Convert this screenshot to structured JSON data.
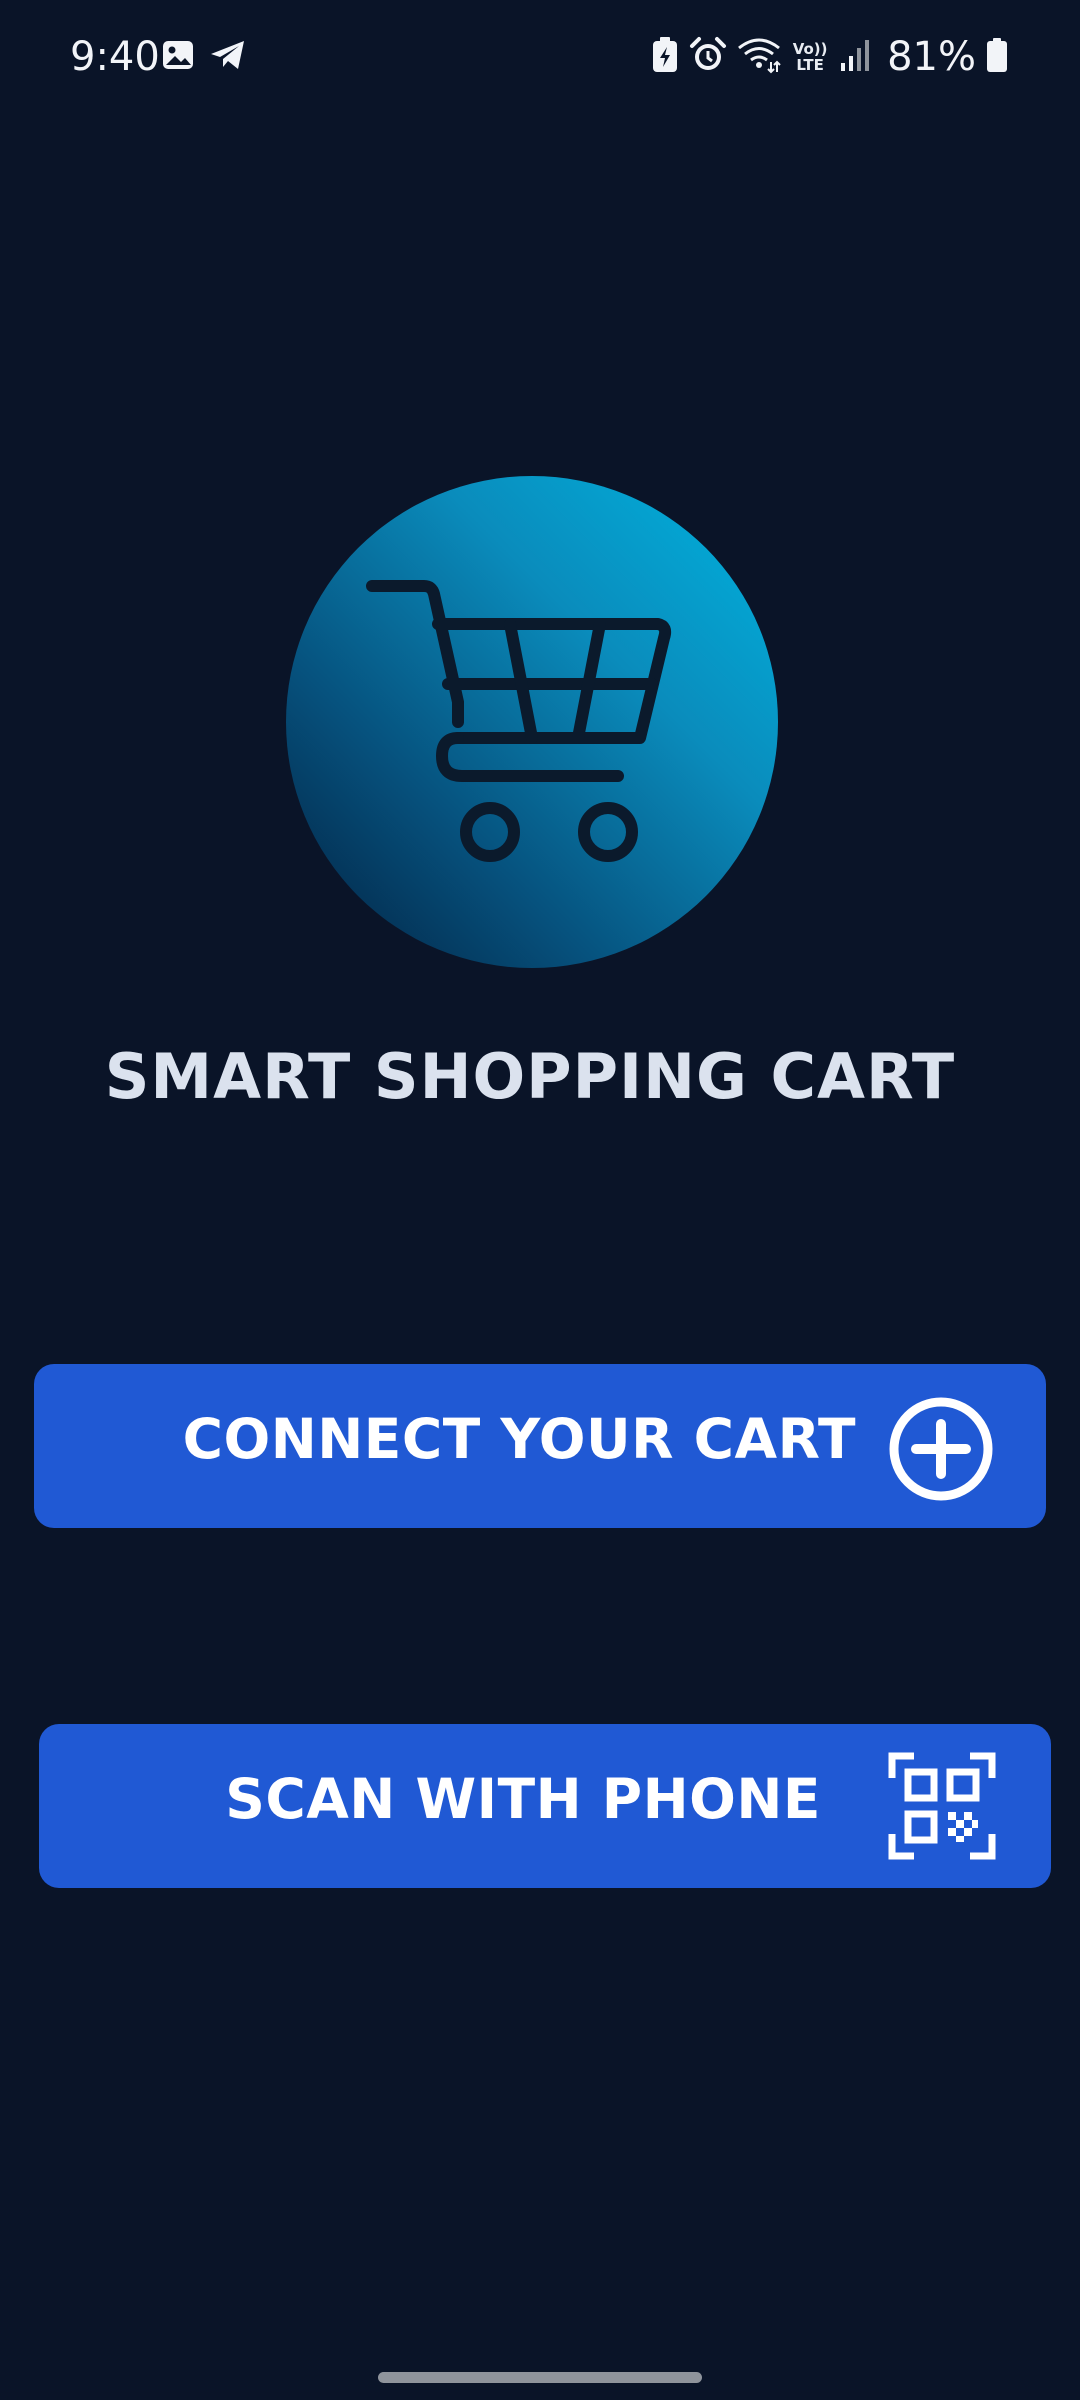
{
  "status_bar": {
    "time": "9:40",
    "network_label": "Vo)) LTE",
    "battery_percent": "81%",
    "left_icons": [
      "image-notification-icon",
      "telegram-icon"
    ],
    "right_icons": [
      "battery-saver-icon",
      "alarm-icon",
      "wifi-icon",
      "volte-icon",
      "cellular-signal-icon",
      "battery-icon"
    ]
  },
  "app": {
    "logo_icon": "shopping-cart-icon",
    "title": "SMART SHOPPING CART"
  },
  "buttons": {
    "connect": {
      "label": "CONNECT YOUR CART",
      "icon": "add-circle-icon"
    },
    "scan": {
      "label": "SCAN WITH PHONE",
      "icon": "qr-code-icon"
    }
  },
  "colors": {
    "background": "#0a1428",
    "button": "#2059d4",
    "title": "#dbe2ee",
    "logo_gradient_light": "#00b4e0",
    "logo_gradient_dark": "#031f3e"
  }
}
